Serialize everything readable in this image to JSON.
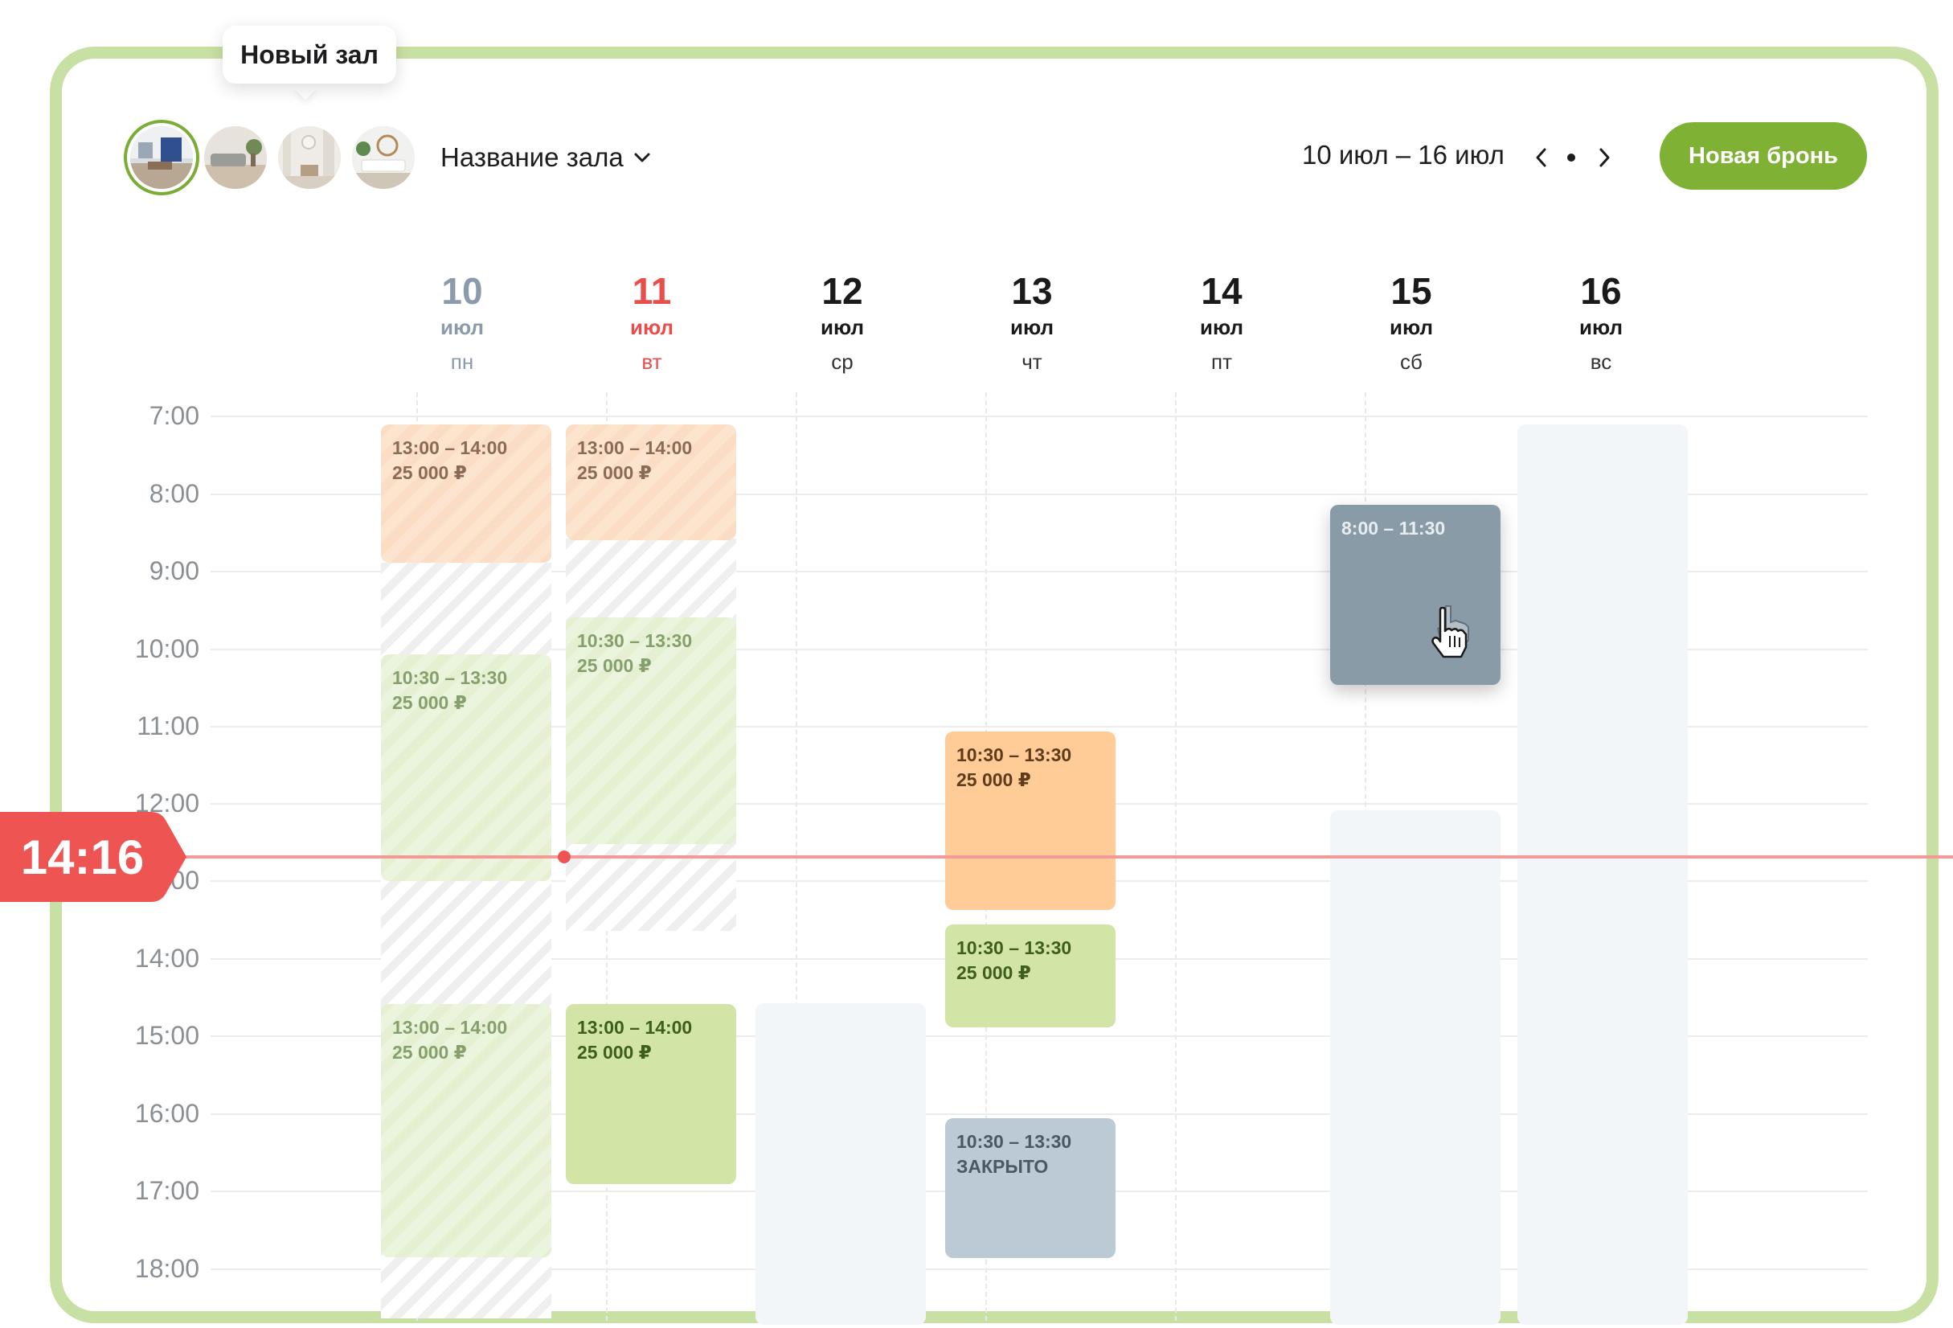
{
  "tooltip": {
    "text": "Новый зал"
  },
  "header": {
    "halls": [
      {
        "name": "hall-1",
        "active": true
      },
      {
        "name": "hall-2",
        "active": false
      },
      {
        "name": "hall-3",
        "active": false
      },
      {
        "name": "hall-4",
        "active": false
      }
    ],
    "hall_select_label": "Название зала",
    "date_range": "10 июл – 16 июл",
    "new_booking_label": "Новая бронь"
  },
  "days": [
    {
      "num": "10",
      "month": "июл",
      "weekday": "пн",
      "state": "past"
    },
    {
      "num": "11",
      "month": "июл",
      "weekday": "вт",
      "state": "today"
    },
    {
      "num": "12",
      "month": "июл",
      "weekday": "ср",
      "state": "future"
    },
    {
      "num": "13",
      "month": "июл",
      "weekday": "чт",
      "state": "future"
    },
    {
      "num": "14",
      "month": "июл",
      "weekday": "пт",
      "state": "future"
    },
    {
      "num": "15",
      "month": "июл",
      "weekday": "сб",
      "state": "future"
    },
    {
      "num": "16",
      "month": "июл",
      "weekday": "вс",
      "state": "future"
    }
  ],
  "hours": [
    "7:00",
    "8:00",
    "9:00",
    "10:00",
    "11:00",
    "12:00",
    "13:00",
    "14:00",
    "15:00",
    "16:00",
    "17:00",
    "18:00"
  ],
  "now": {
    "time": "14:16"
  },
  "events": [
    {
      "time": "13:00 – 14:00",
      "price": "25 000 ₽",
      "style": "peach-faded"
    },
    {
      "time": "10:30 – 13:30",
      "price": "25 000 ₽",
      "style": "green-faded"
    },
    {
      "time": "13:00 – 14:00",
      "price": "25 000 ₽",
      "style": "green-faded"
    },
    {
      "time": "13:00 – 14:00",
      "price": "25 000 ₽",
      "style": "peach-faded"
    },
    {
      "time": "10:30 – 13:30",
      "price": "25 000 ₽",
      "style": "green-faded"
    },
    {
      "time": "13:00 – 14:00",
      "price": "25 000 ₽",
      "style": "green"
    },
    {
      "time": "10:30 – 13:30",
      "price": "25 000 ₽",
      "style": "peach"
    },
    {
      "time": "10:30 – 13:30",
      "price": "25 000 ₽",
      "style": "green"
    },
    {
      "time": "10:30 – 13:30",
      "price": "ЗАКРЫТО",
      "style": "gray"
    },
    {
      "time": "8:00 – 11:30",
      "price": "",
      "style": "dragging"
    }
  ],
  "colors": {
    "accent": "#7fb134",
    "frame": "#c9e0a4",
    "today": "#ea4e4a",
    "now_line": "#f39a98",
    "now_badge": "#ee5552"
  }
}
